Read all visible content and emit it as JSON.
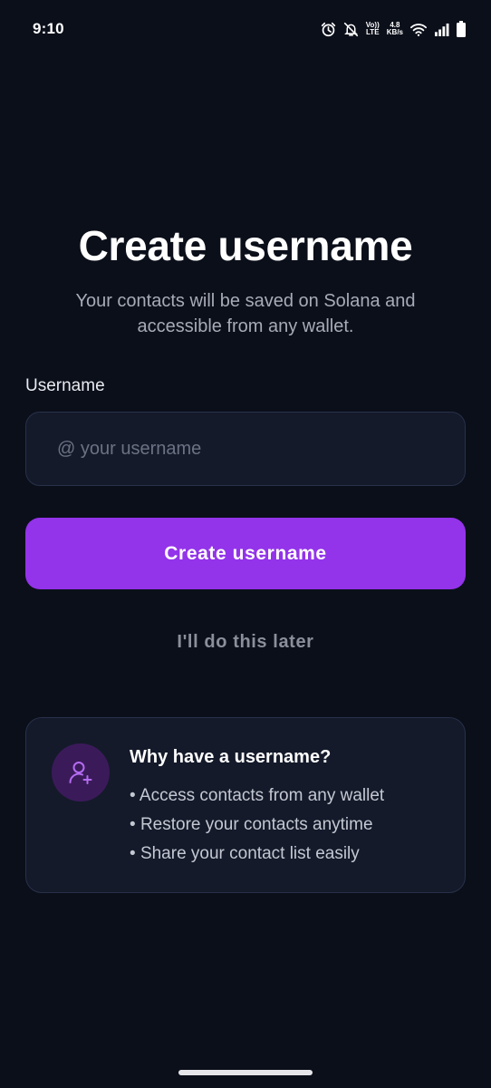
{
  "status_bar": {
    "time": "9:10",
    "lte_top": "Vo))",
    "lte_bottom": "LTE",
    "speed_top": "4.8",
    "speed_bottom": "KB/s"
  },
  "header": {
    "title": "Create username",
    "subtitle": "Your contacts will be saved on Solana and accessible from any wallet."
  },
  "form": {
    "label": "Username",
    "placeholder": "@ your username",
    "value": ""
  },
  "actions": {
    "primary_label": "Create username",
    "secondary_label": "I'll do this later"
  },
  "info": {
    "title": "Why have a username?",
    "items": [
      "Access contacts from any wallet",
      "Restore your contacts anytime",
      "Share your contact list easily"
    ],
    "icon": "user-plus-icon"
  },
  "colors": {
    "background": "#0b0f1a",
    "accent": "#9333ea",
    "card": "#141a2a"
  }
}
